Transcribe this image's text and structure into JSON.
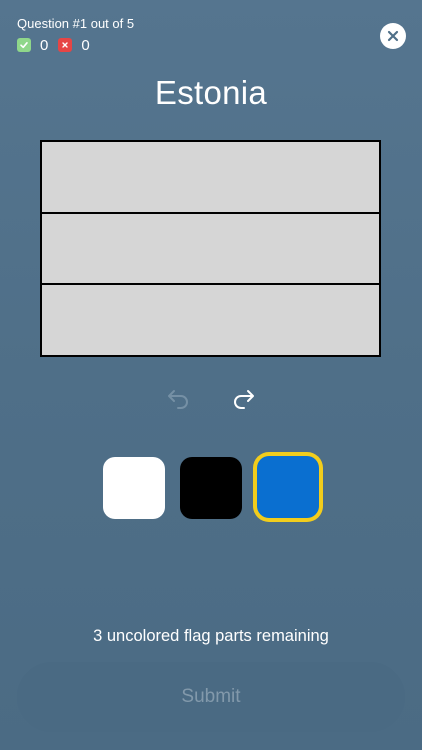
{
  "header": {
    "question_text": "Question #1 out of 5",
    "correct_count": "0",
    "wrong_count": "0",
    "close_icon": "close-icon"
  },
  "quiz": {
    "country": "Estonia"
  },
  "flag": {
    "stripes": [
      {
        "color": "#d6d6d6"
      },
      {
        "color": "#d6d6d6"
      },
      {
        "color": "#d6d6d6"
      }
    ]
  },
  "controls": {
    "undo_icon": "undo-icon",
    "redo_icon": "redo-icon",
    "undo_enabled": false,
    "redo_enabled": true
  },
  "palette": {
    "swatches": [
      {
        "name": "white",
        "color": "#ffffff",
        "selected": false
      },
      {
        "name": "black",
        "color": "#000000",
        "selected": false
      },
      {
        "name": "blue",
        "color": "#0a6fd0",
        "selected": true
      }
    ],
    "selected_border_color": "#f2cd1c"
  },
  "footer": {
    "remaining_text": "3 uncolored flag parts remaining",
    "submit_label": "Submit",
    "submit_enabled": false
  }
}
